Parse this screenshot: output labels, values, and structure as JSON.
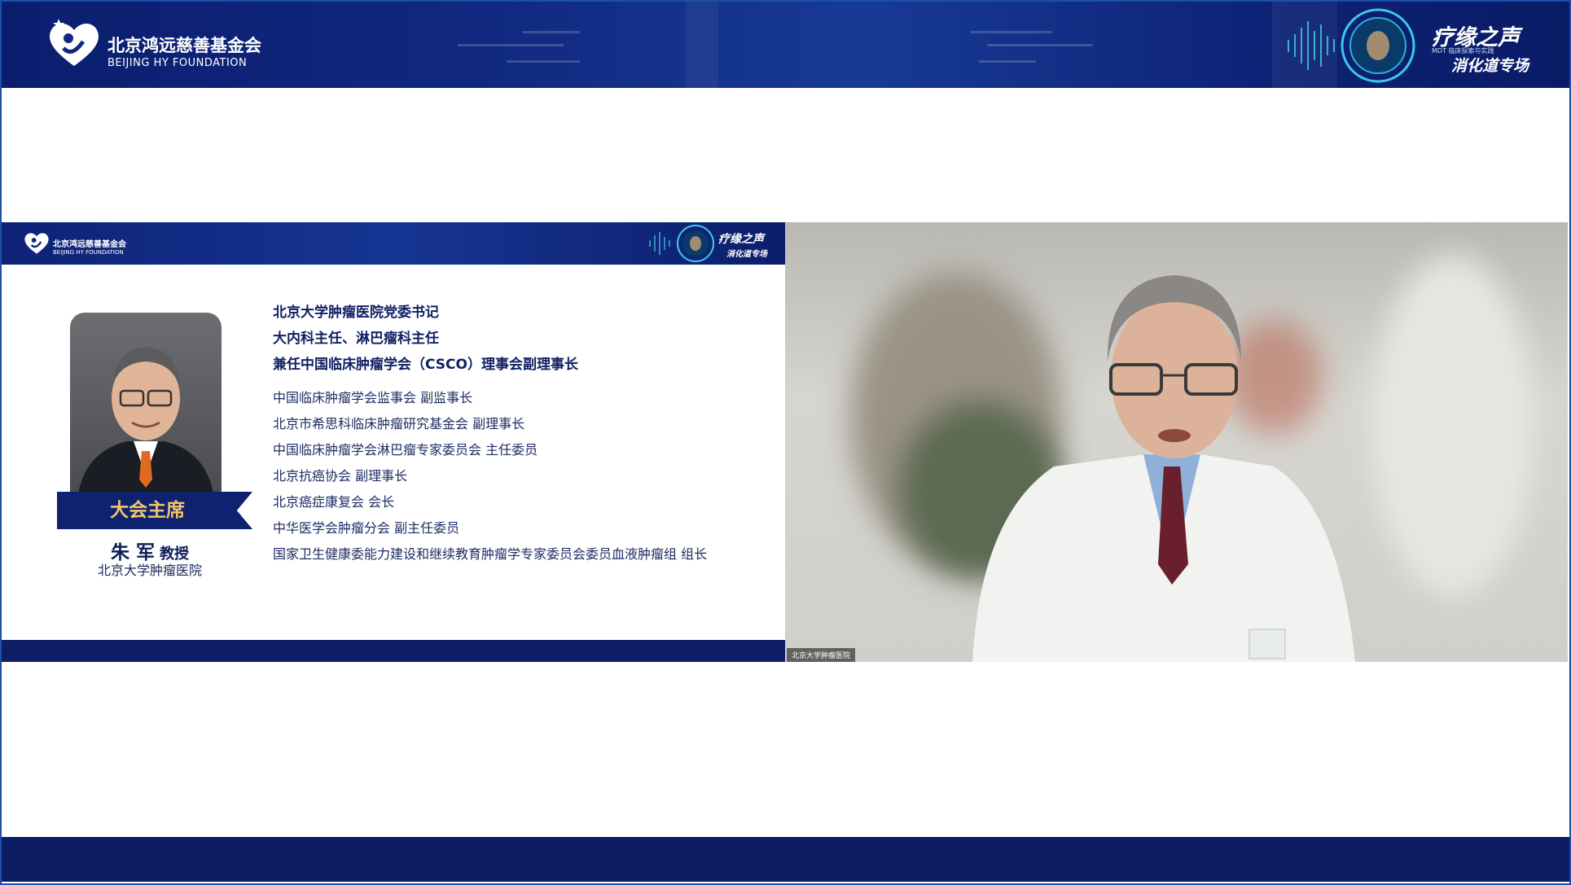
{
  "banner": {
    "org_name_cn": "北京鸿远慈善基金会",
    "org_name_en": "BEIJING HY FOUNDATION",
    "event_title": "疗缘之声",
    "event_tiny": "MDT 临床探索与实践",
    "event_subtitle": "消化道专场"
  },
  "slide": {
    "header": {
      "org_name_cn": "北京鸿远慈善基金会",
      "org_name_en": "BEIJING HY FOUNDATION",
      "event_title": "疗缘之声",
      "event_subtitle": "消化道专场"
    },
    "ribbon_label": "大会主席",
    "speaker": {
      "name": "朱 军",
      "title": "教授",
      "org": "北京大学肿瘤医院"
    },
    "main_roles": [
      "北京大学肿瘤医院党委书记",
      "大内科主任、淋巴瘤科主任",
      "兼任中国临床肿瘤学会（CSCO）理事会副理事长"
    ],
    "sub_roles": [
      "中国临床肿瘤学会监事会 副监事长",
      "北京市希思科临床肿瘤研究基金会 副理事长",
      "中国临床肿瘤学会淋巴瘤专家委员会 主任委员",
      "北京抗癌协会 副理事长",
      "北京癌症康复会 会长",
      "中华医学会肿瘤分会 副主任委员",
      "国家卫生健康委能力建设和继续教育肿瘤学专家委员会委员血液肿瘤组 组长"
    ]
  },
  "video": {
    "participant_label": "北京大学肿瘤医院"
  },
  "colors": {
    "navy": "#0c1d63",
    "banner_blue": "#10287f",
    "ribbon_gold": "#f2c56a",
    "frame": "#1d4fa8"
  }
}
